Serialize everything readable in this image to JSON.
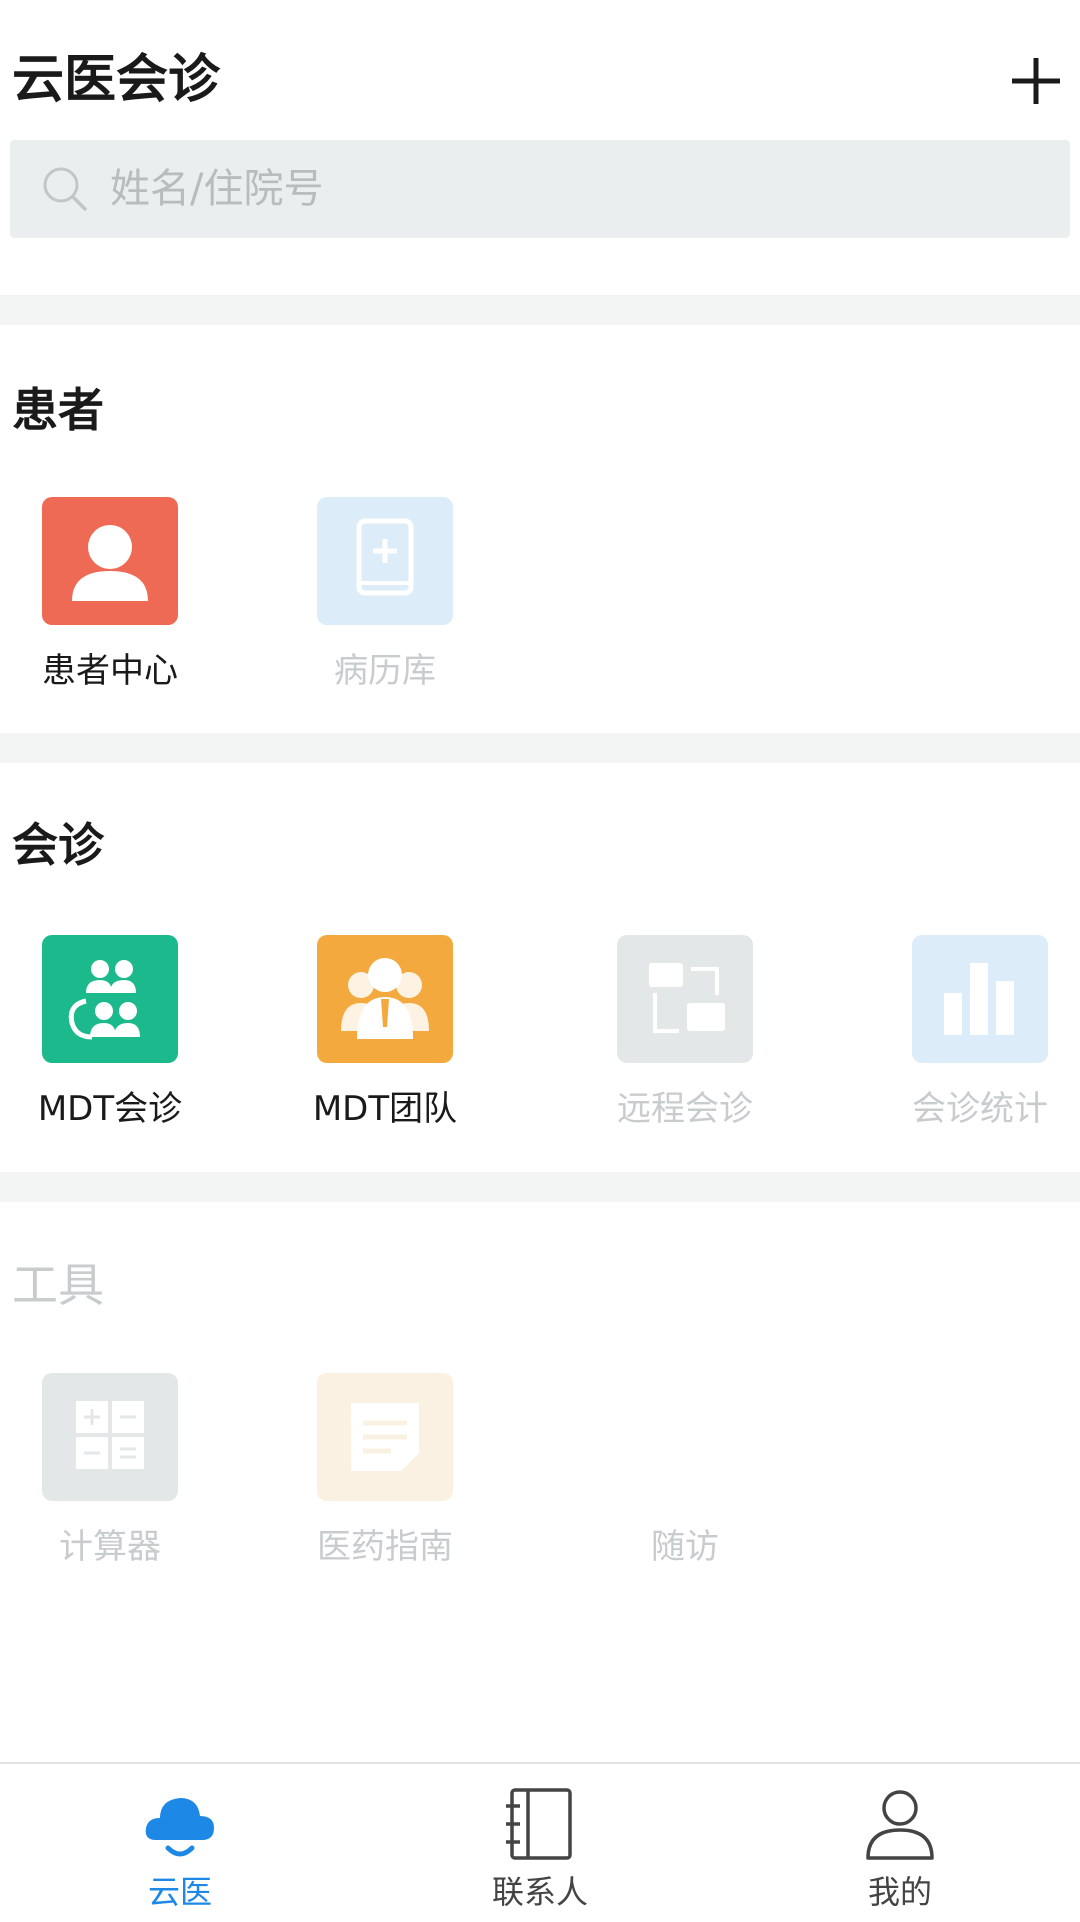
{
  "header": {
    "title": "云医会诊",
    "add_icon": "plus-icon"
  },
  "search": {
    "placeholder": "姓名/住院号",
    "value": "",
    "icon": "search-icon"
  },
  "sections": [
    {
      "title": "患者",
      "enabled": true,
      "items": [
        {
          "label": "患者中心",
          "icon": "person-icon",
          "color": "#ee6a55",
          "enabled": true
        },
        {
          "label": "病历库",
          "icon": "medical-book-icon",
          "color": "#dcecf9",
          "enabled": false
        }
      ]
    },
    {
      "title": "会诊",
      "enabled": true,
      "items": [
        {
          "label": "MDT会诊",
          "icon": "group-consult-icon",
          "color": "#1bb98c",
          "enabled": true
        },
        {
          "label": "MDT团队",
          "icon": "team-icon",
          "color": "#f3a93d",
          "enabled": true
        },
        {
          "label": "远程会诊",
          "icon": "remote-screens-icon",
          "color": "#e4e7e8",
          "enabled": false
        },
        {
          "label": "会诊统计",
          "icon": "bar-chart-icon",
          "color": "#dcecf9",
          "enabled": false
        }
      ]
    },
    {
      "title": "工具",
      "enabled": false,
      "items": [
        {
          "label": "计算器",
          "icon": "calculator-icon",
          "color": "#e4e7e8",
          "enabled": false
        },
        {
          "label": "医药指南",
          "icon": "note-icon",
          "color": "#fbf1e3",
          "enabled": false
        },
        {
          "label": "随访",
          "icon": "",
          "color": "",
          "enabled": false
        }
      ]
    }
  ],
  "tabbar": {
    "items": [
      {
        "label": "云医",
        "icon": "cloud-icon",
        "selected": true
      },
      {
        "label": "联系人",
        "icon": "contacts-book-icon",
        "selected": false
      },
      {
        "label": "我的",
        "icon": "profile-icon",
        "selected": false
      }
    ],
    "accent_color": "#1d88e5"
  }
}
